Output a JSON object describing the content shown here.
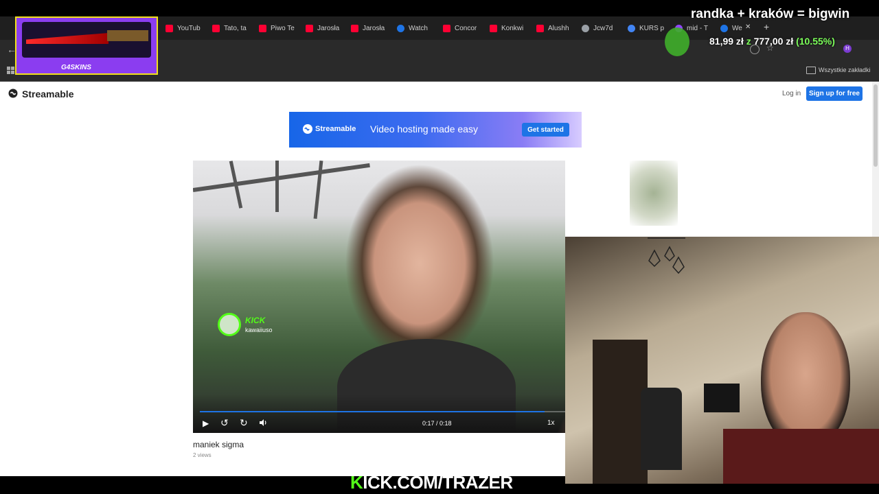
{
  "overlay": {
    "promo_brand": "G4SKINS",
    "goal_title": "randka + kraków = bigwin",
    "goal_current": "81,99 zł",
    "goal_connector": "z",
    "goal_target": "777,00 zł",
    "goal_percent": "(10.55%)",
    "goal_progress_fraction": 0.1055,
    "kick_url": "KICK.COM/TRAZER",
    "kick_url_accent_color": "#53fc18"
  },
  "browser": {
    "tabs": [
      {
        "label": "YouTub",
        "icon": "youtube-icon"
      },
      {
        "label": "Tato, ta",
        "icon": "youtube-icon"
      },
      {
        "label": "Piwo Te",
        "icon": "youtube-icon"
      },
      {
        "label": "Jarosła",
        "icon": "youtube-icon"
      },
      {
        "label": "Jarosła",
        "icon": "youtube-icon"
      },
      {
        "label": "Watch",
        "icon": "streamable-icon"
      },
      {
        "label": "Concor",
        "icon": "youtube-icon"
      },
      {
        "label": "Konkwi",
        "icon": "youtube-icon"
      },
      {
        "label": "Alushh",
        "icon": "youtube-icon"
      },
      {
        "label": "Jcw7d",
        "icon": "globe-icon"
      },
      {
        "label": "KURS p",
        "icon": "google-icon"
      },
      {
        "label": "mid - T",
        "icon": "twitch-icon"
      },
      {
        "label": "We",
        "icon": "streamable-icon"
      }
    ],
    "new_tab": "+",
    "bookmarks_folder": "Wszystkie zakładki"
  },
  "site": {
    "brand": "Streamable",
    "login": "Log in",
    "signup": "Sign up for free",
    "ad": {
      "brand": "Streamable",
      "tagline": "Video hosting made easy",
      "cta": "Get started"
    },
    "video": {
      "overlay_brand": "KICK",
      "overlay_channel": "kawaiiuso",
      "time": "0:17 / 0:18",
      "speed": "1x",
      "progress_fraction": 0.944,
      "title": "maniek sigma",
      "views": "2 views"
    }
  },
  "colors": {
    "youtube": "#ff0033",
    "streamable_blue": "#1e74e6",
    "kick_green": "#53fc18",
    "goal_green": "#7cff5a",
    "promo_purple": "#8b3df0"
  }
}
